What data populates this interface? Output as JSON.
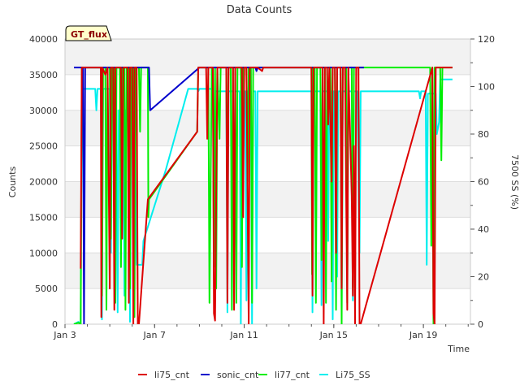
{
  "chart_data": {
    "type": "line",
    "title": "Data Counts",
    "badge": "GT_flux",
    "xlabel": "Time",
    "ylabel": "Counts",
    "y2label": "7500 SS (%)",
    "x_ticks": [
      {
        "label": "Jan 3",
        "day": 3
      },
      {
        "label": "Jan 7",
        "day": 7
      },
      {
        "label": "Jan 11",
        "day": 11
      },
      {
        "label": "Jan 15",
        "day": 15
      },
      {
        "label": "Jan 19",
        "day": 19
      }
    ],
    "xlim": [
      3,
      21.1
    ],
    "ylim": [
      0,
      40000
    ],
    "y_ticks": [
      0,
      5000,
      10000,
      15000,
      20000,
      25000,
      30000,
      35000,
      40000
    ],
    "y2lim": [
      0,
      120
    ],
    "y2_ticks": [
      0,
      20,
      40,
      60,
      80,
      100,
      120
    ],
    "grid": true,
    "legend_position": "bottom",
    "series": [
      {
        "name": "li75_cnt",
        "color": "#dd0000",
        "axis": "left",
        "points": [
          [
            3.7,
            7800
          ],
          [
            3.75,
            36000
          ],
          [
            4.6,
            36000
          ],
          [
            4.62,
            1000
          ],
          [
            4.66,
            36000
          ],
          [
            4.8,
            35000
          ],
          [
            4.9,
            36000
          ],
          [
            5.0,
            5000
          ],
          [
            5.05,
            36000
          ],
          [
            5.15,
            36000
          ],
          [
            5.2,
            2000
          ],
          [
            5.25,
            36000
          ],
          [
            5.5,
            36000
          ],
          [
            5.55,
            12000
          ],
          [
            5.6,
            36000
          ],
          [
            5.8,
            36000
          ],
          [
            5.85,
            3000
          ],
          [
            5.9,
            36000
          ],
          [
            6.0,
            36000
          ],
          [
            6.05,
            0
          ],
          [
            6.1,
            36000
          ],
          [
            6.2,
            36000
          ],
          [
            6.25,
            0
          ],
          [
            6.3,
            0
          ],
          [
            6.7,
            17500
          ],
          [
            8.9,
            27000
          ],
          [
            8.95,
            36000
          ],
          [
            9.3,
            36000
          ],
          [
            9.35,
            26000
          ],
          [
            9.4,
            36000
          ],
          [
            9.6,
            36000
          ],
          [
            9.65,
            1500
          ],
          [
            9.7,
            500
          ],
          [
            9.8,
            36000
          ],
          [
            10.2,
            36000
          ],
          [
            10.25,
            3000
          ],
          [
            10.3,
            36000
          ],
          [
            10.5,
            36000
          ],
          [
            10.55,
            2000
          ],
          [
            10.6,
            36000
          ],
          [
            10.9,
            36000
          ],
          [
            10.95,
            15000
          ],
          [
            11.0,
            36000
          ],
          [
            11.1,
            36000
          ],
          [
            11.2,
            0
          ],
          [
            11.25,
            36000
          ],
          [
            11.6,
            36000
          ],
          [
            11.8,
            35500
          ],
          [
            11.85,
            36000
          ],
          [
            14.0,
            36000
          ],
          [
            14.05,
            4000
          ],
          [
            14.1,
            36000
          ],
          [
            14.5,
            36000
          ],
          [
            14.55,
            0
          ],
          [
            14.6,
            36000
          ],
          [
            14.7,
            36000
          ],
          [
            14.75,
            28000
          ],
          [
            14.8,
            36000
          ],
          [
            14.9,
            20000
          ],
          [
            14.95,
            36000
          ],
          [
            15.05,
            36000
          ],
          [
            15.1,
            10000
          ],
          [
            15.15,
            36000
          ],
          [
            15.3,
            36000
          ],
          [
            15.35,
            5000
          ],
          [
            15.4,
            36000
          ],
          [
            15.5,
            36000
          ],
          [
            15.6,
            2000
          ],
          [
            15.65,
            36000
          ],
          [
            15.8,
            18000
          ],
          [
            15.85,
            4000
          ],
          [
            15.9,
            25000
          ],
          [
            15.95,
            0
          ],
          [
            16.0,
            36000
          ],
          [
            16.1,
            36000
          ],
          [
            16.15,
            0
          ],
          [
            16.2,
            0
          ],
          [
            19.4,
            36000
          ],
          [
            19.45,
            1500
          ],
          [
            19.5,
            0
          ],
          [
            19.55,
            36000
          ],
          [
            20.3,
            36000
          ]
        ]
      },
      {
        "name": "sonic_cnt",
        "color": "#0000cc",
        "axis": "left",
        "points": [
          [
            3.4,
            36000
          ],
          [
            3.8,
            36000
          ],
          [
            3.85,
            0
          ],
          [
            3.9,
            36000
          ],
          [
            6.75,
            36000
          ],
          [
            6.8,
            30000
          ],
          [
            9.0,
            36000
          ],
          [
            11.5,
            36000
          ],
          [
            11.55,
            35500
          ],
          [
            11.6,
            36000
          ],
          [
            16.3,
            36000
          ],
          [
            16.35,
            36000
          ]
        ]
      },
      {
        "name": "li77_cnt",
        "color": "#00ee00",
        "axis": "left",
        "points": [
          [
            3.4,
            0
          ],
          [
            3.6,
            200
          ],
          [
            3.7,
            0
          ],
          [
            3.75,
            36000
          ],
          [
            4.6,
            36000
          ],
          [
            4.65,
            4000
          ],
          [
            4.7,
            36000
          ],
          [
            4.8,
            36000
          ],
          [
            4.85,
            2000
          ],
          [
            4.9,
            36000
          ],
          [
            5.0,
            36000
          ],
          [
            5.05,
            12000
          ],
          [
            5.1,
            36000
          ],
          [
            5.2,
            36000
          ],
          [
            5.25,
            3000
          ],
          [
            5.3,
            36000
          ],
          [
            5.45,
            36000
          ],
          [
            5.5,
            8000
          ],
          [
            5.55,
            36000
          ],
          [
            5.65,
            36000
          ],
          [
            5.7,
            2000
          ],
          [
            5.75,
            36000
          ],
          [
            5.85,
            36000
          ],
          [
            5.9,
            5000
          ],
          [
            5.95,
            36000
          ],
          [
            6.05,
            36000
          ],
          [
            6.1,
            1000
          ],
          [
            6.15,
            36000
          ],
          [
            6.3,
            36000
          ],
          [
            6.35,
            27000
          ],
          [
            6.4,
            36000
          ],
          [
            6.7,
            36000
          ],
          [
            6.72,
            15000
          ],
          [
            6.75,
            17500
          ],
          [
            8.9,
            27000
          ],
          [
            8.95,
            36000
          ],
          [
            9.4,
            36000
          ],
          [
            9.45,
            3000
          ],
          [
            9.5,
            19000
          ],
          [
            9.55,
            36000
          ],
          [
            9.6,
            36000
          ],
          [
            9.65,
            8000
          ],
          [
            9.7,
            36000
          ],
          [
            9.75,
            5000
          ],
          [
            9.8,
            36000
          ],
          [
            9.9,
            26000
          ],
          [
            9.95,
            36000
          ],
          [
            10.2,
            36000
          ],
          [
            10.25,
            16000
          ],
          [
            10.3,
            36000
          ],
          [
            10.4,
            36000
          ],
          [
            10.45,
            2000
          ],
          [
            10.5,
            36000
          ],
          [
            10.6,
            36000
          ],
          [
            10.65,
            3000
          ],
          [
            10.7,
            36000
          ],
          [
            10.85,
            36000
          ],
          [
            10.9,
            8000
          ],
          [
            10.95,
            36000
          ],
          [
            11.1,
            36000
          ],
          [
            11.15,
            20000
          ],
          [
            11.2,
            36000
          ],
          [
            11.3,
            36000
          ],
          [
            11.35,
            3000
          ],
          [
            11.4,
            36000
          ],
          [
            14.0,
            36000
          ],
          [
            14.03,
            7000
          ],
          [
            14.06,
            36000
          ],
          [
            14.15,
            36000
          ],
          [
            14.2,
            3000
          ],
          [
            14.25,
            36000
          ],
          [
            14.4,
            36000
          ],
          [
            14.45,
            9000
          ],
          [
            14.5,
            36000
          ],
          [
            14.6,
            36000
          ],
          [
            14.65,
            3000
          ],
          [
            14.7,
            36000
          ],
          [
            14.85,
            36000
          ],
          [
            14.9,
            6000
          ],
          [
            14.95,
            36000
          ],
          [
            15.05,
            36000
          ],
          [
            15.1,
            2000
          ],
          [
            15.15,
            36000
          ],
          [
            15.3,
            36000
          ],
          [
            15.35,
            0
          ],
          [
            15.4,
            36000
          ],
          [
            15.55,
            36000
          ],
          [
            15.6,
            3000
          ],
          [
            15.65,
            36000
          ],
          [
            15.8,
            36000
          ],
          [
            15.85,
            5000
          ],
          [
            15.9,
            36000
          ],
          [
            16.05,
            36000
          ],
          [
            16.1,
            36000
          ],
          [
            19.3,
            36000
          ],
          [
            19.35,
            11000
          ],
          [
            19.4,
            36000
          ],
          [
            19.45,
            0
          ],
          [
            19.5,
            36000
          ],
          [
            19.75,
            36000
          ],
          [
            19.8,
            23000
          ],
          [
            19.85,
            36000
          ],
          [
            20.3,
            36000
          ]
        ]
      },
      {
        "name": "Li75_SS",
        "color": "#00eeee",
        "axis": "right",
        "points": [
          [
            3.4,
            0
          ],
          [
            3.6,
            1
          ],
          [
            3.7,
            0
          ],
          [
            3.75,
            99
          ],
          [
            4.35,
            99
          ],
          [
            4.4,
            90
          ],
          [
            4.45,
            99
          ],
          [
            4.6,
            99
          ],
          [
            4.65,
            2
          ],
          [
            4.7,
            99
          ],
          [
            5.0,
            99
          ],
          [
            5.05,
            30
          ],
          [
            5.1,
            90
          ],
          [
            5.3,
            90
          ],
          [
            5.35,
            5
          ],
          [
            5.4,
            90
          ],
          [
            5.6,
            90
          ],
          [
            5.65,
            12
          ],
          [
            5.7,
            90
          ],
          [
            5.85,
            90
          ],
          [
            5.9,
            1
          ],
          [
            5.95,
            90
          ],
          [
            6.1,
            90
          ],
          [
            6.2,
            25
          ],
          [
            6.45,
            25
          ],
          [
            6.5,
            35
          ],
          [
            7.5,
            65
          ],
          [
            8.5,
            99
          ],
          [
            8.9,
            99
          ],
          [
            8.95,
            98
          ],
          [
            9.0,
            99
          ],
          [
            9.6,
            99
          ],
          [
            9.65,
            50
          ],
          [
            9.7,
            98
          ],
          [
            10.2,
            98
          ],
          [
            10.25,
            5
          ],
          [
            10.3,
            98
          ],
          [
            10.5,
            98
          ],
          [
            10.55,
            40
          ],
          [
            10.6,
            98
          ],
          [
            10.8,
            98
          ],
          [
            10.85,
            0
          ],
          [
            10.9,
            98
          ],
          [
            11.05,
            98
          ],
          [
            11.1,
            10
          ],
          [
            11.15,
            98
          ],
          [
            11.3,
            98
          ],
          [
            11.35,
            0
          ],
          [
            11.4,
            98
          ],
          [
            11.5,
            98
          ],
          [
            11.55,
            15
          ],
          [
            11.6,
            98
          ],
          [
            11.8,
            98
          ],
          [
            11.85,
            98
          ],
          [
            12.8,
            98
          ],
          [
            13.9,
            98
          ],
          [
            14.0,
            98
          ],
          [
            14.05,
            5
          ],
          [
            14.1,
            98
          ],
          [
            14.4,
            98
          ],
          [
            14.45,
            8
          ],
          [
            14.5,
            98
          ],
          [
            14.7,
            98
          ],
          [
            14.75,
            35
          ],
          [
            14.8,
            98
          ],
          [
            14.9,
            98
          ],
          [
            14.95,
            2
          ],
          [
            15.0,
            98
          ],
          [
            15.1,
            98
          ],
          [
            15.15,
            20
          ],
          [
            15.2,
            98
          ],
          [
            15.3,
            98
          ],
          [
            15.35,
            5
          ],
          [
            15.4,
            98
          ],
          [
            15.55,
            98
          ],
          [
            15.6,
            15
          ],
          [
            15.65,
            98
          ],
          [
            15.8,
            98
          ],
          [
            15.85,
            10
          ],
          [
            15.9,
            98
          ],
          [
            16.05,
            98
          ],
          [
            16.15,
            30
          ],
          [
            16.2,
            98
          ],
          [
            18.8,
            98
          ],
          [
            18.85,
            95
          ],
          [
            18.9,
            98
          ],
          [
            19.1,
            98
          ],
          [
            19.15,
            25
          ],
          [
            19.2,
            97
          ],
          [
            19.55,
            97
          ],
          [
            19.6,
            80
          ],
          [
            19.7,
            85
          ],
          [
            19.75,
            103
          ],
          [
            20.3,
            103
          ]
        ]
      }
    ]
  }
}
